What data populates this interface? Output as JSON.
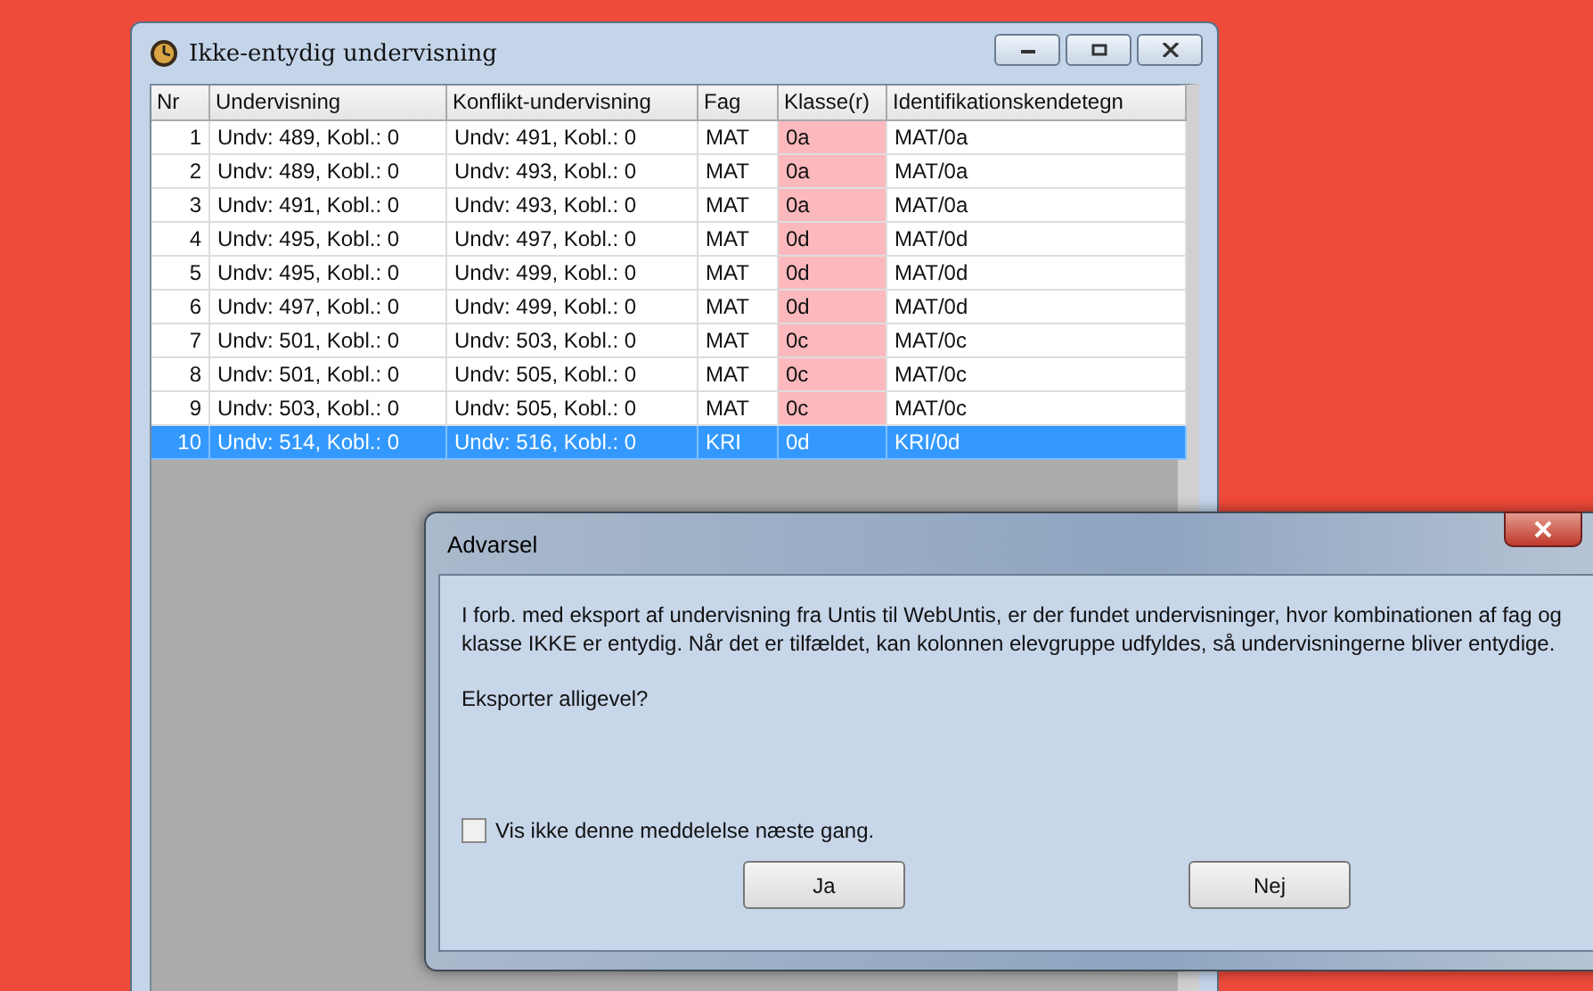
{
  "main_window": {
    "title": "Ikke-entydig undervisning"
  },
  "table": {
    "columns": [
      "Nr",
      "Undervisning",
      "Konflikt-undervisning",
      "Fag",
      "Klasse(r)",
      "Identifikationskendetegn"
    ],
    "rows": [
      {
        "nr": "1",
        "undervisning": "Undv: 489, Kobl.: 0",
        "konflikt": "Undv: 491, Kobl.: 0",
        "fag": "MAT",
        "klasse": "0a",
        "ident": "MAT/0a",
        "selected": false
      },
      {
        "nr": "2",
        "undervisning": "Undv: 489, Kobl.: 0",
        "konflikt": "Undv: 493, Kobl.: 0",
        "fag": "MAT",
        "klasse": "0a",
        "ident": "MAT/0a",
        "selected": false
      },
      {
        "nr": "3",
        "undervisning": "Undv: 491, Kobl.: 0",
        "konflikt": "Undv: 493, Kobl.: 0",
        "fag": "MAT",
        "klasse": "0a",
        "ident": "MAT/0a",
        "selected": false
      },
      {
        "nr": "4",
        "undervisning": "Undv: 495, Kobl.: 0",
        "konflikt": "Undv: 497, Kobl.: 0",
        "fag": "MAT",
        "klasse": "0d",
        "ident": "MAT/0d",
        "selected": false
      },
      {
        "nr": "5",
        "undervisning": "Undv: 495, Kobl.: 0",
        "konflikt": "Undv: 499, Kobl.: 0",
        "fag": "MAT",
        "klasse": "0d",
        "ident": "MAT/0d",
        "selected": false
      },
      {
        "nr": "6",
        "undervisning": "Undv: 497, Kobl.: 0",
        "konflikt": "Undv: 499, Kobl.: 0",
        "fag": "MAT",
        "klasse": "0d",
        "ident": "MAT/0d",
        "selected": false
      },
      {
        "nr": "7",
        "undervisning": "Undv: 501, Kobl.: 0",
        "konflikt": "Undv: 503, Kobl.: 0",
        "fag": "MAT",
        "klasse": "0c",
        "ident": "MAT/0c",
        "selected": false
      },
      {
        "nr": "8",
        "undervisning": "Undv: 501, Kobl.: 0",
        "konflikt": "Undv: 505, Kobl.: 0",
        "fag": "MAT",
        "klasse": "0c",
        "ident": "MAT/0c",
        "selected": false
      },
      {
        "nr": "9",
        "undervisning": "Undv: 503, Kobl.: 0",
        "konflikt": "Undv: 505, Kobl.: 0",
        "fag": "MAT",
        "klasse": "0c",
        "ident": "MAT/0c",
        "selected": false
      },
      {
        "nr": "10",
        "undervisning": "Undv: 514, Kobl.: 0",
        "konflikt": "Undv: 516, Kobl.: 0",
        "fag": "KRI",
        "klasse": "0d",
        "ident": "KRI/0d",
        "selected": true
      }
    ]
  },
  "dialog": {
    "title": "Advarsel",
    "message": "I forb. med eksport af undervisning fra Untis til WebUntis, er der fundet undervisninger, hvor kombinationen af fag og klasse IKKE er entydig. Når det er tilfældet, kan kolonnen elevgruppe udfyldes, så undervisningerne bliver entydige.",
    "question": "Eksporter alligevel?",
    "checkbox": {
      "label": "Vis ikke denne meddelelse næste gang.",
      "checked": false
    },
    "buttons": [
      "Ja",
      "Nej"
    ]
  }
}
